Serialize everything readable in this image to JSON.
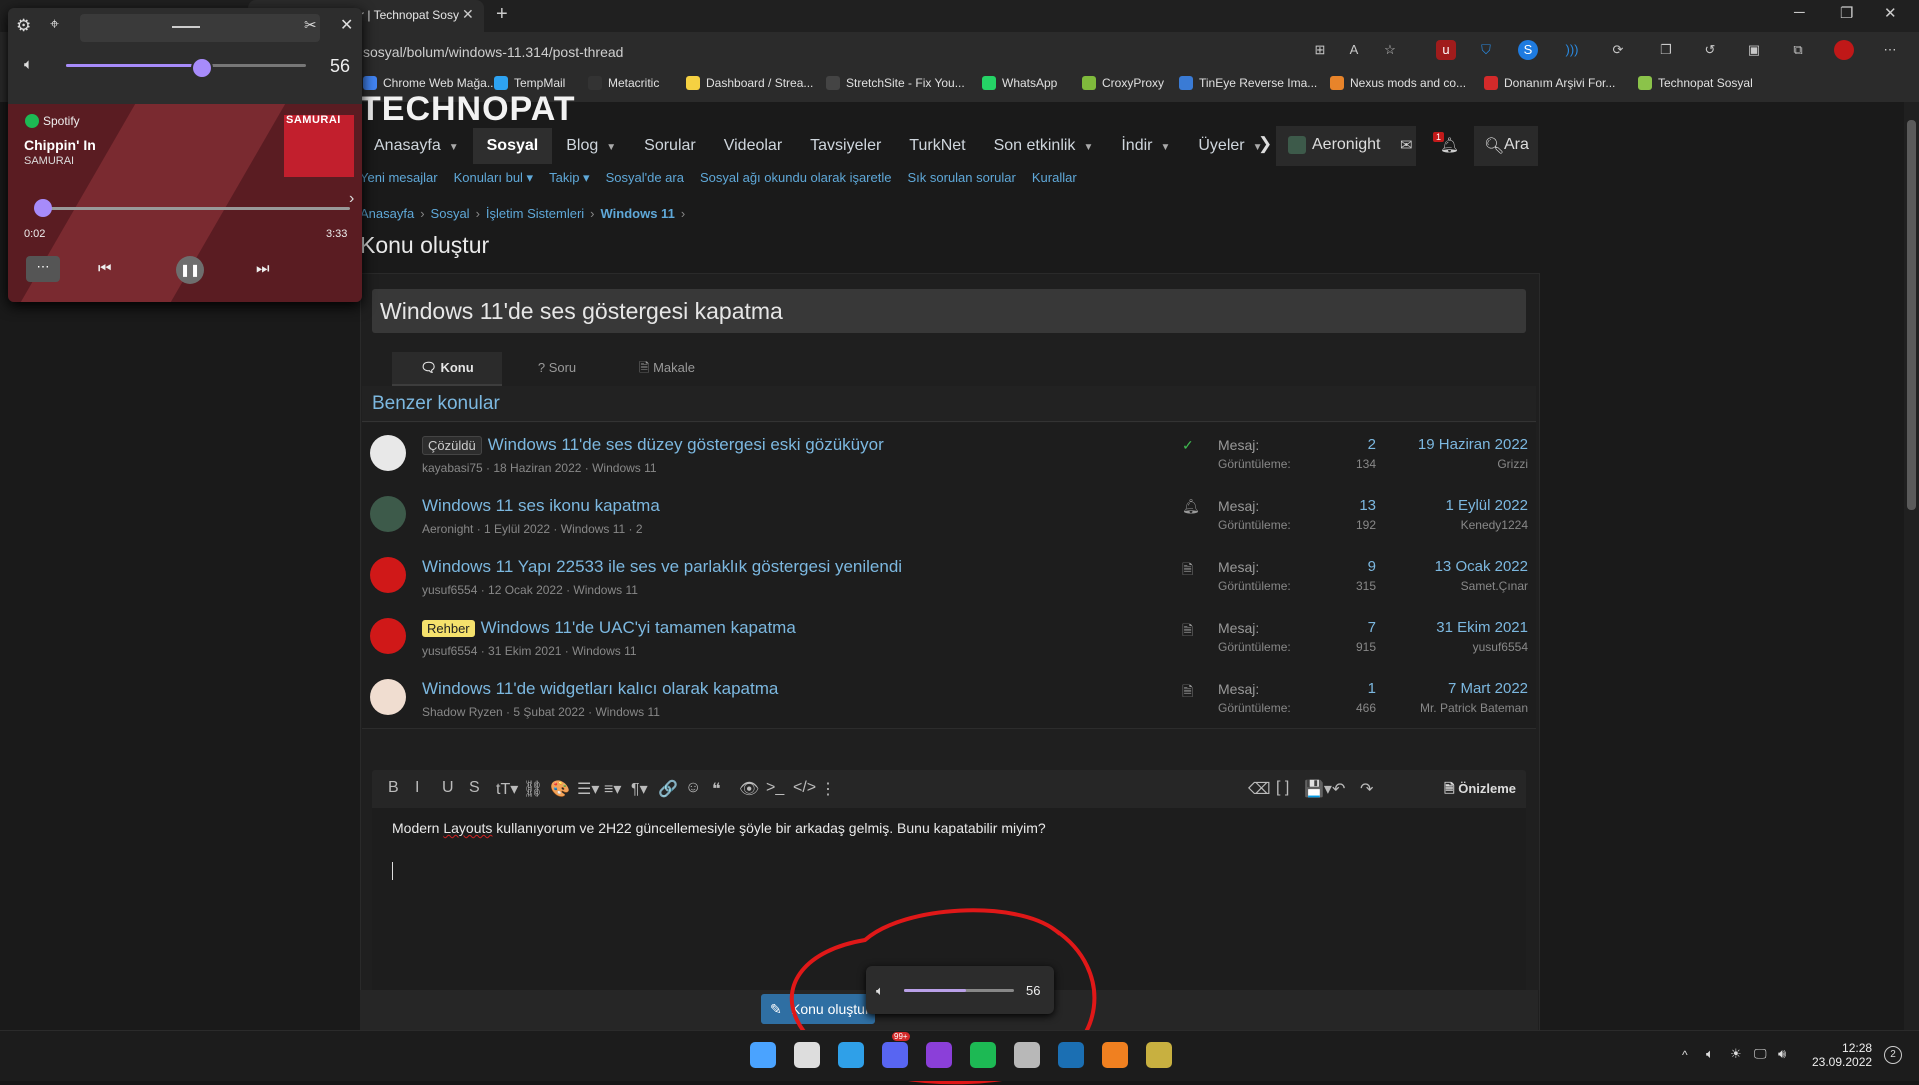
{
  "browser": {
    "tab_title": "r | Technopat Sosy",
    "tab_close": "✕",
    "new_tab": "+",
    "url": "sosyal/bolum/windows-11.314/post-thread",
    "window_controls": [
      "─",
      "❐",
      "✕"
    ],
    "toolbar_icons": [
      "split-screen-icon",
      "read-aloud-icon",
      "favorite-add-icon",
      "ublock-icon",
      "shield-icon",
      "translate-icon",
      "wifi-icon",
      "extensions-icon",
      "collections-icon",
      "history-icon",
      "screenshot-icon",
      "tab-actions-icon",
      "profile-icon",
      "more-icon"
    ],
    "bookmarks": [
      {
        "label": "Chrome Web Mağa...",
        "icon": "chrome-store-icon",
        "color": "#4285f4"
      },
      {
        "label": "TempMail",
        "icon": "tempmail-icon",
        "color": "#2ea3f2"
      },
      {
        "label": "Metacritic",
        "icon": "metacritic-icon",
        "color": "#333333"
      },
      {
        "label": "Dashboard / Strea...",
        "icon": "streamlabs-icon",
        "color": "#f5d142"
      },
      {
        "label": "StretchSite - Fix You...",
        "icon": "stretchsite-icon",
        "color": "#444444"
      },
      {
        "label": "WhatsApp",
        "icon": "whatsapp-icon",
        "color": "#25d366"
      },
      {
        "label": "CroxyProxy",
        "icon": "croxyproxy-icon",
        "color": "#7fba3c"
      },
      {
        "label": "TinEye Reverse Ima...",
        "icon": "tineye-icon",
        "color": "#3a7bd5"
      },
      {
        "label": "Nexus mods and co...",
        "icon": "nexus-icon",
        "color": "#e8842a"
      },
      {
        "label": "Donanım Arşivi For...",
        "icon": "donanim-icon",
        "color": "#d42a2a"
      },
      {
        "label": "Technopat Sosyal",
        "icon": "technopat-power-icon",
        "color": "#8bc34a"
      }
    ]
  },
  "site": {
    "logo": "TECHNOPAT",
    "nav": [
      {
        "label": "Anasayfa",
        "caret": true,
        "active": false
      },
      {
        "label": "Sosyal",
        "caret": false,
        "active": true
      },
      {
        "label": "Blog",
        "caret": true,
        "active": false
      },
      {
        "label": "Sorular",
        "caret": false,
        "active": false
      },
      {
        "label": "Videolar",
        "caret": false,
        "active": false
      },
      {
        "label": "Tavsiyeler",
        "caret": false,
        "active": false
      },
      {
        "label": "TurkNet",
        "caret": false,
        "active": false
      },
      {
        "label": "Son etkinlik",
        "caret": true,
        "active": false
      },
      {
        "label": "İndir",
        "caret": true,
        "active": false
      },
      {
        "label": "Üyeler",
        "caret": true,
        "active": false
      }
    ],
    "nav_more": "❯",
    "username": "Aeronight",
    "notification_count": "1",
    "search_label": "Ara",
    "subnav": [
      "Yeni mesajlar",
      "Konuları bul ▾",
      "Takip ▾",
      "Sosyal'de ara",
      "Sosyal ağı okundu olarak işaretle",
      "Sık sorulan sorular",
      "Kurallar"
    ],
    "breadcrumb": [
      "Anasayfa",
      "Sosyal",
      "İşletim Sistemleri",
      "Windows 11"
    ],
    "breadcrumb_sep": "›",
    "page_title": "Konu oluştur",
    "thread_title_value": "Windows 11'de ses göstergesi kapatma",
    "thread_types": [
      {
        "label": "Konu",
        "icon": "chat-icon",
        "active": true
      },
      {
        "label": "Soru",
        "icon": "question-icon",
        "active": false
      },
      {
        "label": "Makale",
        "icon": "article-icon",
        "active": false
      }
    ],
    "similar_heading": "Benzer konular",
    "stat_labels": {
      "replies": "Mesaj:",
      "views": "Görüntüleme:"
    },
    "similar": [
      {
        "prefix": "Çözüldü",
        "prefix_style": "solved",
        "title": "Windows 11'de ses düzey göstergesi eski gözüküyor",
        "meta": "kayabasi75 · 18 Haziran 2022 · Windows 11",
        "status_icon": "check-circle-icon",
        "replies": "2",
        "views": "134",
        "date": "19 Haziran 2022",
        "last_user": "Grizzi",
        "avatar_color": "#e8e8e8"
      },
      {
        "prefix": "",
        "prefix_style": "",
        "title": "Windows 11 ses ikonu kapatma",
        "meta": "Aeronight · 1 Eylül 2022 · Windows 11 · 2",
        "status_icon": "bell-icon",
        "replies": "13",
        "views": "192",
        "date": "1 Eylül 2022",
        "last_user": "Kenedy1224",
        "avatar_color": "#3d5a4a"
      },
      {
        "prefix": "",
        "prefix_style": "",
        "title": "Windows 11 Yapı 22533 ile ses ve parlaklık göstergesi yenilendi",
        "meta": "yusuf6554 · 12 Ocak 2022 · Windows 11",
        "status_icon": "document-icon",
        "replies": "9",
        "views": "315",
        "date": "13 Ocak 2022",
        "last_user": "Samet.Çınar",
        "avatar_color": "#d01818"
      },
      {
        "prefix": "Rehber",
        "prefix_style": "guide",
        "title": "Windows 11'de UAC'yi tamamen kapatma",
        "meta": "yusuf6554 · 31 Ekim 2021 · Windows 11",
        "status_icon": "document-icon",
        "replies": "7",
        "views": "915",
        "date": "31 Ekim 2021",
        "last_user": "yusuf6554",
        "avatar_color": "#d01818"
      },
      {
        "prefix": "",
        "prefix_style": "",
        "title": "Windows 11'de widgetları kalıcı olarak kapatma",
        "meta": "Shadow Ryzen · 5 Şubat 2022 · Windows 11",
        "status_icon": "document-icon",
        "replies": "1",
        "views": "466",
        "date": "7 Mart 2022",
        "last_user": "Mr. Patrick Bateman",
        "avatar_color": "#f0ddd0"
      }
    ],
    "editor": {
      "toolbar_left": [
        "B",
        "I",
        "U",
        "S",
        "tT▾",
        "⛓",
        "🎨",
        "☰▾",
        "≡▾",
        "¶▾",
        "🔗",
        "☺",
        "❝",
        "👁",
        ">_",
        "</>",
        "⋮"
      ],
      "toolbar_right": [
        "⌫",
        "[ ]",
        "💾▾",
        "↶",
        "↷"
      ],
      "preview_label": "Önizleme",
      "text_before": "Modern ",
      "text_misspelled": "Layouts",
      "text_after": " kullanıyorum ve 2H22 güncellemesiyle şöyle bir arkadaş gelmiş. Bunu kapatabilir miyim?"
    },
    "submit_label": "Konu oluştur"
  },
  "volume_osd": {
    "value": 56,
    "label": "56",
    "icon": "speaker-icon"
  },
  "media_flyout": {
    "icons": [
      "settings-icon",
      "pin-icon",
      "drag-handle-icon",
      "unpin-icon",
      "close-icon"
    ],
    "volume": 56,
    "volume_label": "56",
    "source": "Spotify",
    "track": "Chippin' In",
    "artist": "SAMURAI",
    "album_text": "SAMURAI",
    "position": "0:02",
    "duration": "3:33",
    "progress": 0.01,
    "controls": [
      "more-icon",
      "previous-icon",
      "pause-icon",
      "next-icon"
    ]
  },
  "taskbar": {
    "apps": [
      {
        "icon": "windows-start-icon",
        "color": "#4aa3ff"
      },
      {
        "icon": "search-icon",
        "color": "#dddddd"
      },
      {
        "icon": "edge-icon",
        "color": "#2fa0e8"
      },
      {
        "icon": "discord-icon",
        "color": "#5865f2"
      },
      {
        "icon": "cortana-icon",
        "color": "#8b3fd9"
      },
      {
        "icon": "spotify-icon",
        "color": "#1db954"
      },
      {
        "icon": "anime-app-icon",
        "color": "#b8b8b8"
      },
      {
        "icon": "steam-icon",
        "color": "#1b6fb3"
      },
      {
        "icon": "ng-icon",
        "color": "#f08020"
      },
      {
        "icon": "game-icon",
        "color": "#c8b040"
      }
    ],
    "discord_badge": "99+",
    "tray": [
      "chevron-up-icon",
      "volume-icon",
      "brightness-icon",
      "network-icon",
      "speaker-icon"
    ],
    "time": "12:28",
    "date": "23.09.2022",
    "notification_badge": "2"
  }
}
